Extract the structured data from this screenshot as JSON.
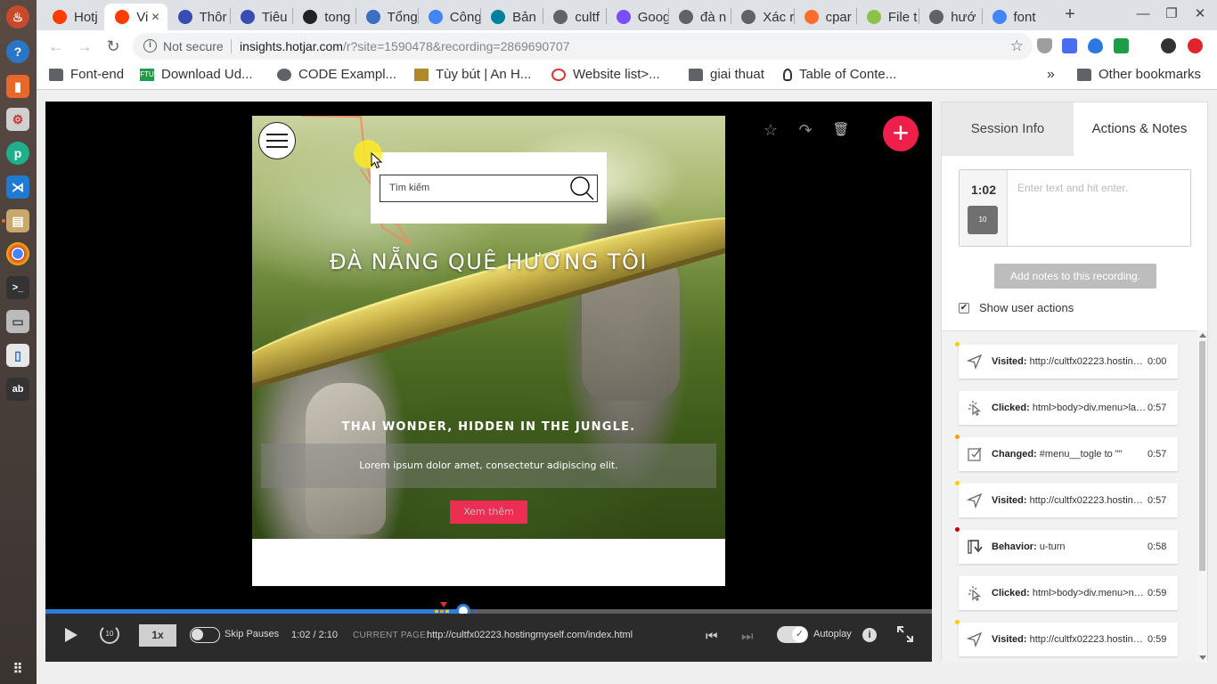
{
  "dock": {
    "items": [
      "hotjar",
      "help",
      "office",
      "settings",
      "phpstorm",
      "vscode",
      "files",
      "chrome",
      "terminal",
      "scanner",
      "writer",
      "dict"
    ],
    "apps_icon": "grid-icon"
  },
  "browser": {
    "tabs": [
      {
        "title": "Hotj",
        "favicon_color": "#ff3c00"
      },
      {
        "title": "Vi",
        "favicon_color": "#ff3c00",
        "active": true
      },
      {
        "title": "Thôr",
        "favicon_color": "#3a4cb1"
      },
      {
        "title": "Tiêu",
        "favicon_color": "#3a4cb1"
      },
      {
        "title": "tong",
        "favicon_color": "#222222"
      },
      {
        "title": "Tổng",
        "favicon_color": "#3c6fc4"
      },
      {
        "title": "Công",
        "favicon_color": "#4285f4"
      },
      {
        "title": "Bản",
        "favicon_color": "#00809d"
      },
      {
        "title": "cultf",
        "favicon_color": "#5f6368"
      },
      {
        "title": "Goog",
        "favicon_color": "#7c4dff"
      },
      {
        "title": "đà n",
        "favicon_color": "#5f6368"
      },
      {
        "title": "Xác r",
        "favicon_color": "#5f6368"
      },
      {
        "title": "cpar",
        "favicon_color": "#ff6c2c"
      },
      {
        "title": "File t",
        "favicon_color": "#8bc34a"
      },
      {
        "title": "hướ",
        "favicon_color": "#5f6368"
      },
      {
        "title": "font",
        "favicon_color": "#4285f4"
      }
    ],
    "new_tab": "+",
    "address": {
      "security": "Not secure",
      "host": "insights.hotjar.com",
      "path": "/r?site=1590478&recording=2869690707"
    },
    "bookmarks": [
      {
        "label": "Font-end",
        "icon": "folder"
      },
      {
        "label": "Download Ud...",
        "icon": "ftu"
      },
      {
        "label": "CODE Exampl...",
        "icon": "globe"
      },
      {
        "label": "Tùy bút | An H...",
        "icon": "image"
      },
      {
        "label": "Website list>...",
        "icon": "swirl"
      },
      {
        "label": "giai thuat",
        "icon": "folder"
      },
      {
        "label": "Table of Conte...",
        "icon": "bulb"
      }
    ],
    "more_bookmarks": "»",
    "other_bookmarks": "Other bookmarks"
  },
  "recording": {
    "site": {
      "search_placeholder": "Tìm kiếm",
      "title": "ĐÀ NẴNG QUÊ HƯƠNG TÔI",
      "subtitle": "THAI WONDER, HIDDEN IN THE JUNGLE.",
      "description": "Lorem ipsum dolor amet, consectetur adipiscing elit.",
      "button": "Xem thêm"
    },
    "tools": {
      "favorite": "☆",
      "share": "↷",
      "delete": "🗑",
      "add": "+"
    }
  },
  "player": {
    "progress": 0.4711,
    "marker": 0.4495,
    "speed": "1x",
    "skip_label": "Skip Pauses",
    "time": "1:02 / 2:10",
    "current_page_label": "CURRENT PAGE:",
    "current_page_url": "http://cultfx02223.hostingmyself.com/index.html",
    "autoplay_label": "Autoplay"
  },
  "panel": {
    "tabs": [
      "Session Info",
      "Actions & Notes"
    ],
    "note_time": "1:02",
    "note_placeholder": "Enter text and hit enter.",
    "add_notes": "Add notes to this recording.",
    "show_actions": "Show user actions",
    "actions": [
      {
        "type": "Visited:",
        "detail": "http://cultfx02223.hostingm...",
        "time": "0:00",
        "dot": "#f0d000",
        "icon": "navigate-icon"
      },
      {
        "type": "Clicked:",
        "detail": "html>body>div.menu>label...",
        "time": "0:57",
        "dot": "",
        "icon": "click-icon"
      },
      {
        "type": "Changed:",
        "detail": "#menu__togle to \"\"",
        "time": "0:57",
        "dot": "#f0a000",
        "icon": "edit-icon"
      },
      {
        "type": "Visited:",
        "detail": "http://cultfx02223.hostingm...",
        "time": "0:57",
        "dot": "#f0d000",
        "icon": "navigate-icon"
      },
      {
        "type": "Behavior:",
        "detail": "u-turn",
        "time": "0:58",
        "dot": "#c00000",
        "icon": "u-turn-icon"
      },
      {
        "type": "Clicked:",
        "detail": "html>body>div.menu>nav...",
        "time": "0:59",
        "dot": "",
        "icon": "click-icon"
      },
      {
        "type": "Visited:",
        "detail": "http://cultfx02223.hostingm...",
        "time": "0:59",
        "dot": "#f0d000",
        "icon": "navigate-icon"
      }
    ]
  }
}
